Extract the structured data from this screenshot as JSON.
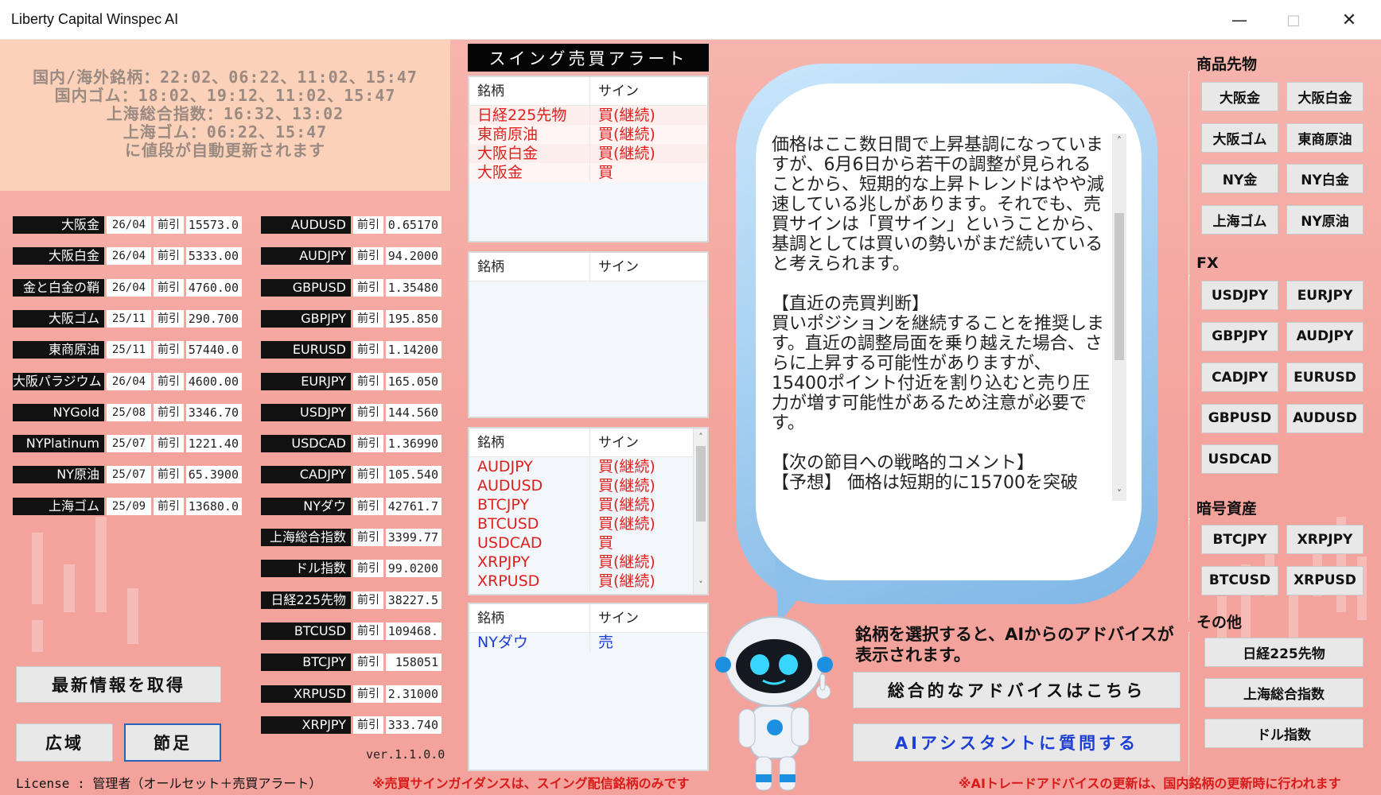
{
  "window": {
    "title": "Liberty Capital Winspec AI"
  },
  "update_info": [
    "国内/海外銘柄：22:02、06:22、11:02、15:47",
    "国内ゴム：18:02、19:12、11:02、15:47",
    "上海総合指数：16:32、13:02",
    "上海ゴム：06:22、15:47",
    "に値段が自動更新されます"
  ],
  "prices_left": [
    {
      "name": "大阪金",
      "month": "26/04",
      "tag": "前引",
      "value": "15573.0"
    },
    {
      "name": "大阪白金",
      "month": "26/04",
      "tag": "前引",
      "value": "5333.00"
    },
    {
      "name": "金と白金の鞘",
      "month": "26/04",
      "tag": "前引",
      "value": "4760.00"
    },
    {
      "name": "大阪ゴム",
      "month": "25/11",
      "tag": "前引",
      "value": "290.700"
    },
    {
      "name": "東商原油",
      "month": "25/11",
      "tag": "前引",
      "value": "57440.0"
    },
    {
      "name": "大阪パラジウム",
      "month": "26/04",
      "tag": "前引",
      "value": "4600.00"
    },
    {
      "name": "NYGold",
      "month": "25/08",
      "tag": "前引",
      "value": "3346.70"
    },
    {
      "name": "NYPlatinum",
      "month": "25/07",
      "tag": "前引",
      "value": "1221.40"
    },
    {
      "name": "NY原油",
      "month": "25/07",
      "tag": "前引",
      "value": "65.3900"
    },
    {
      "name": "上海ゴム",
      "month": "25/09",
      "tag": "前引",
      "value": "13680.0"
    }
  ],
  "prices_right": [
    {
      "name": "AUDUSD",
      "tag": "前引",
      "value": "0.65170"
    },
    {
      "name": "AUDJPY",
      "tag": "前引",
      "value": "94.2000"
    },
    {
      "name": "GBPUSD",
      "tag": "前引",
      "value": "1.35480"
    },
    {
      "name": "GBPJPY",
      "tag": "前引",
      "value": "195.850"
    },
    {
      "name": "EURUSD",
      "tag": "前引",
      "value": "1.14200"
    },
    {
      "name": "EURJPY",
      "tag": "前引",
      "value": "165.050"
    },
    {
      "name": "USDJPY",
      "tag": "前引",
      "value": "144.560"
    },
    {
      "name": "USDCAD",
      "tag": "前引",
      "value": "1.36990"
    },
    {
      "name": "CADJPY",
      "tag": "前引",
      "value": "105.540"
    },
    {
      "name": "NYダウ",
      "tag": "前引",
      "value": "42761.7"
    },
    {
      "name": "上海総合指数",
      "tag": "前引",
      "value": "3399.77"
    },
    {
      "name": "ドル指数",
      "tag": "前引",
      "value": "99.0200"
    },
    {
      "name": "日経225先物",
      "tag": "前引",
      "value": "38227.5"
    },
    {
      "name": "BTCUSD",
      "tag": "前引",
      "value": "109468."
    },
    {
      "name": "BTCJPY",
      "tag": "前引",
      "value": "158051"
    },
    {
      "name": "XRPUSD",
      "tag": "前引",
      "value": "2.31000"
    },
    {
      "name": "XRPJPY",
      "tag": "前引",
      "value": "333.740"
    }
  ],
  "buttons": {
    "refresh": "最新情報を取得",
    "wide": "広域",
    "candle": "節足"
  },
  "version": "ver.1.1.0.0",
  "license": "License : 管理者（オールセット＋売買アラート）",
  "note_left": "※売買サインガイダンスは、スイング配信銘柄のみです",
  "note_right": "※AIトレードアドバイスの更新は、国内銘柄の更新時に行われます",
  "alert": {
    "header": "スイング売買アラート",
    "col_name": "銘柄",
    "col_sign": "サイン",
    "tables": [
      {
        "rows": [
          {
            "name": "日経225先物",
            "sign": "買(継続)"
          },
          {
            "name": "東商原油",
            "sign": "買(継続)"
          },
          {
            "name": "大阪白金",
            "sign": "買(継続)"
          },
          {
            "name": "大阪金",
            "sign": "買"
          }
        ]
      },
      {
        "rows": []
      },
      {
        "rows": [
          {
            "name": "AUDJPY",
            "sign": "買(継続)"
          },
          {
            "name": "AUDUSD",
            "sign": "買(継続)"
          },
          {
            "name": "BTCJPY",
            "sign": "買(継続)"
          },
          {
            "name": "BTCUSD",
            "sign": "買(継続)"
          },
          {
            "name": "USDCAD",
            "sign": "買"
          },
          {
            "name": "XRPJPY",
            "sign": "買(継続)"
          },
          {
            "name": "XRPUSD",
            "sign": "買(継続)"
          }
        ]
      },
      {
        "rows": [
          {
            "name": "NYダウ",
            "sign": "売"
          }
        ]
      }
    ]
  },
  "advice_text": "価格はここ数日間で上昇基調になっていますが、6月6日から若干の調整が見られることから、短期的な上昇トレンドはやや減速している兆しがあります。それでも、売買サインは「買サイン」ということから、基調としては買いの勢いがまだ続いていると考えられます。\n\n【直近の売買判断】\n買いポジションを継続することを推奨します。直近の調整局面を乗り越えた場合、さらに上昇する可能性がありますが、15400ポイント付近を割り込むと売り圧力が増す可能性があるため注意が必要です。\n\n【次の節目への戦略的コメント】\n【予想】 価格は短期的に15700を突破",
  "select_message": "銘柄を選択すると、AIからのアドバイスが表示されます。",
  "advice_buttons": {
    "overall": "総合的なアドバイスはこちら",
    "ask": "AIアシスタントに質問する"
  },
  "groups": {
    "commodities": {
      "title": "商品先物",
      "items": [
        "大阪金",
        "大阪白金",
        "大阪ゴム",
        "東商原油",
        "NY金",
        "NY白金",
        "上海ゴム",
        "NY原油"
      ]
    },
    "fx": {
      "title": "FX",
      "items": [
        "USDJPY",
        "EURJPY",
        "GBPJPY",
        "AUDJPY",
        "CADJPY",
        "EURUSD",
        "GBPUSD",
        "AUDUSD",
        "USDCAD"
      ]
    },
    "crypto": {
      "title": "暗号資産",
      "items": [
        "BTCJPY",
        "XRPJPY",
        "BTCUSD",
        "XRPUSD"
      ]
    },
    "other": {
      "title": "その他",
      "items": [
        "日経225先物",
        "上海総合指数",
        "ドル指数"
      ]
    }
  },
  "colors": {
    "buy": "#e0201c",
    "sell": "#1d3fd6",
    "accent": "#2a62b8"
  }
}
